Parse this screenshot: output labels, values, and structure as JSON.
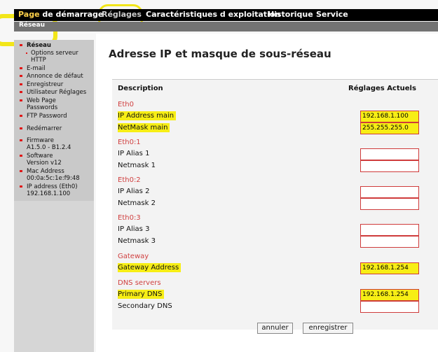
{
  "topnav": {
    "home_prefix": "Page",
    "home_rest": " de démarrage",
    "settings": "Réglages",
    "operating": "Caractéristiques d exploitation",
    "history": "Historique",
    "service": "Service"
  },
  "subnav": {
    "active": "Réseau"
  },
  "sidebar": {
    "network": "Réseau",
    "http_options": "Options serveur",
    "http_options_2": "HTTP",
    "email": "E-mail",
    "fault": "Annonce de défaut",
    "recorder": "Enregistreur",
    "user_settings": "Utilisateur Réglages",
    "web_passwords": "Web Page",
    "web_passwords_2": "Passwords",
    "ftp_password": "FTP Password",
    "restart": "Redémarrer",
    "firmware_label": "Firmware",
    "firmware_value": "A1.5.0 - B1.2.4",
    "software_label": "Software",
    "software_value": "Version v12",
    "mac_label": "Mac Address",
    "mac_value": "00:0a:5c:1e:f9:48",
    "ip_label": "IP address (Eth0)",
    "ip_value": "192.168.1.100"
  },
  "main": {
    "title": "Adresse IP et masque de sous-réseau",
    "col_description": "Description",
    "col_current": "Réglages Actuels",
    "eth0": "Eth0",
    "ip_main_label": "IP Address main",
    "ip_main_value": "192.168.1.100",
    "netmask_main_label": "NetMask main",
    "netmask_main_value": "255.255.255.0",
    "eth01": "Eth0:1",
    "alias1_label": "IP Alias 1",
    "netmask1_label": "Netmask 1",
    "eth02": "Eth0:2",
    "alias2_label": "IP Alias 2",
    "netmask2_label": "Netmask 2",
    "eth03": "Eth0:3",
    "alias3_label": "IP Alias 3",
    "netmask3_label": "Netmask 3",
    "gateway_section": "Gateway",
    "gateway_label": "Gateway Address",
    "gateway_value": "192.168.1.254",
    "dns_section": "DNS servers",
    "primary_dns_label": "Primary DNS",
    "primary_dns_value": "192.168.1.254",
    "secondary_dns_label": "Secondary DNS",
    "cancel": "annuler",
    "save": "enregistrer"
  },
  "colors": {
    "nav_bg": "#000000",
    "active_nav": "#ffd24a",
    "bullet": "#e01818",
    "section_text": "#d04040",
    "highlight": "#f7ee15"
  }
}
